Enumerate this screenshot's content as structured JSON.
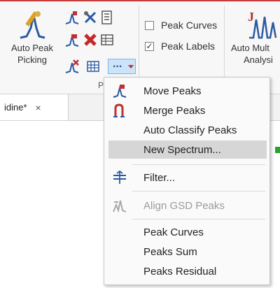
{
  "ribbon": {
    "auto_peak_line1": "Auto Peak",
    "auto_peak_line2": "Picking",
    "group_label_partial": "P",
    "peak_curves_label": "Peak Curves",
    "peak_curves_checked": false,
    "peak_labels_label": "Peak Labels",
    "peak_labels_checked": true,
    "auto_multi_line1": "Auto Mult",
    "auto_multi_line2": "Analysi",
    "more_button_label": "...",
    "accent_color": "#c43b3b"
  },
  "document_tab": {
    "label": "idine*",
    "close_glyph": "×"
  },
  "context_menu": {
    "items": [
      {
        "label": "Move Peaks",
        "icon": "move-peaks-icon",
        "enabled": true,
        "highlighted": false
      },
      {
        "label": "Merge Peaks",
        "icon": "merge-peaks-icon",
        "enabled": true,
        "highlighted": false
      },
      {
        "label": "Auto Classify Peaks",
        "icon": "",
        "enabled": true,
        "highlighted": false
      },
      {
        "label": "New Spectrum...",
        "icon": "",
        "enabled": true,
        "highlighted": true
      },
      {
        "label": "Filter...",
        "icon": "filter-icon",
        "enabled": true,
        "highlighted": false
      },
      {
        "label": "Align GSD Peaks",
        "icon": "align-gsd-icon",
        "enabled": false,
        "highlighted": false
      },
      {
        "label": "Peak Curves",
        "icon": "",
        "enabled": true,
        "highlighted": false
      },
      {
        "label": "Peaks Sum",
        "icon": "",
        "enabled": true,
        "highlighted": false
      },
      {
        "label": "Peaks Residual",
        "icon": "",
        "enabled": true,
        "highlighted": false
      }
    ],
    "highlight_color": "#d6d6d6"
  }
}
